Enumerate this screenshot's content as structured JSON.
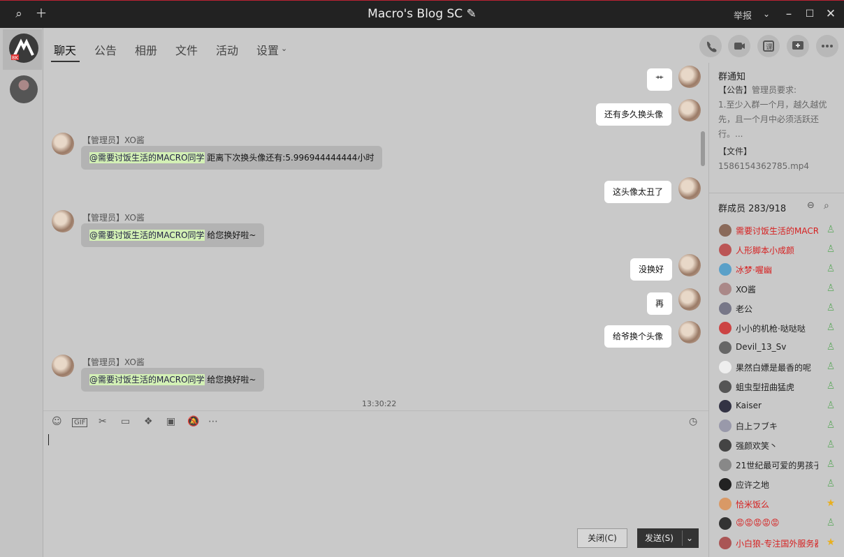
{
  "window": {
    "title": "Macro's Blog SC",
    "report_label": "举报"
  },
  "tabs": [
    {
      "label": "聊天"
    },
    {
      "label": "公告"
    },
    {
      "label": "相册"
    },
    {
      "label": "文件"
    },
    {
      "label": "活动"
    },
    {
      "label": "设置"
    }
  ],
  "rail": {
    "logo_badge": "8K"
  },
  "messages": {
    "m1": "艹",
    "m2": "还有多久换头像",
    "m3_sender": "【管理员】XO酱",
    "m3_mention": "@需要讨饭生活的MACRO同学",
    "m3_text": " 距离下次换头像还有:5.996944444444小时",
    "m4": "这头像太丑了",
    "m5_sender": "【管理员】XO酱",
    "m5_mention": "@需要讨饭生活的MACRO同学",
    "m5_text": " 给您换好啦~",
    "m6": "没换好",
    "m7": "再",
    "m8": "给爷换个头像",
    "m9_sender": "【管理员】XO酱",
    "m9_mention": "@需要讨饭生活的MACRO同学",
    "m9_text": " 给您换好啦~",
    "time": "13:30:22"
  },
  "input": {
    "close_label": "关闭(C)",
    "send_label": "发送(S)"
  },
  "sidebar": {
    "notice_title": "群通知",
    "notice_tag": "【公告】",
    "notice_text": "管理员要求:",
    "notice_body": "1.至少入群一个月，越久越优先，且一个月中必须活跃还行。...",
    "file_tag": "【文件】",
    "file_name": "1586154362785.mp4",
    "members_title": "群成员 283/918",
    "members": [
      {
        "name": "需要讨饭生活的MACRO同学",
        "red": true
      },
      {
        "name": "人形脚本小成颜",
        "red": true
      },
      {
        "name": "冰梦·喔幽",
        "red": true
      },
      {
        "name": "XO酱",
        "red": false
      },
      {
        "name": "老公",
        "red": false
      },
      {
        "name": "小小的机枪·哒哒哒",
        "red": false
      },
      {
        "name": "Devil_13_Sv",
        "red": false
      },
      {
        "name": "果然白嫖是最香的呢",
        "red": false
      },
      {
        "name": "蛆虫型扭曲猛虎",
        "red": false
      },
      {
        "name": "Kaiser",
        "red": false
      },
      {
        "name": "白上フブキ",
        "red": false
      },
      {
        "name": "强颜欢笑丶",
        "red": false
      },
      {
        "name": "21世纪最可爱的男孩子",
        "red": false
      },
      {
        "name": "应许之地",
        "red": false
      },
      {
        "name": "恰米饭么",
        "red": true
      },
      {
        "name": "😡😡😡😡😡",
        "red": true
      },
      {
        "name": "小白狼-专注国外服务器",
        "red": true
      }
    ]
  }
}
